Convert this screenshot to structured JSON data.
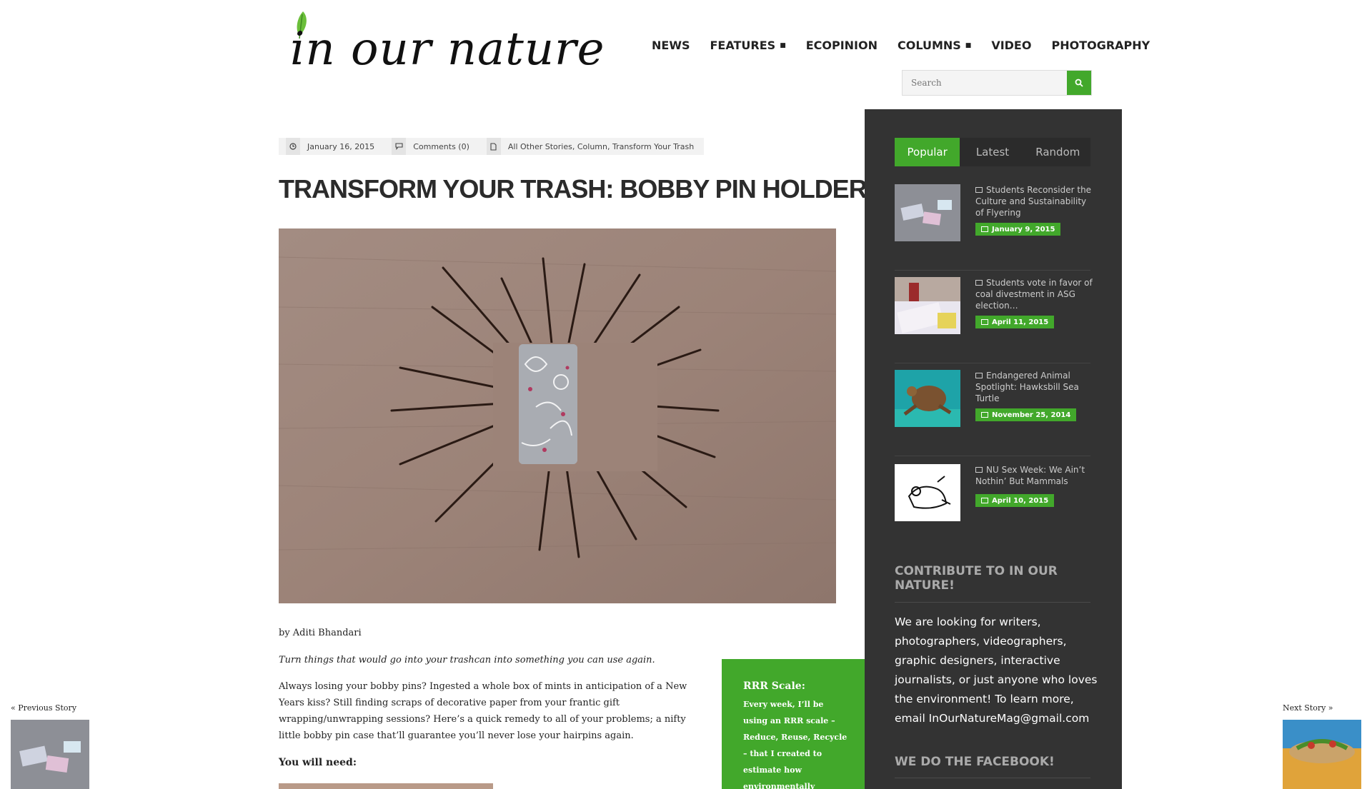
{
  "header": {
    "logo_text": "in our nature",
    "nav": [
      {
        "label": "NEWS",
        "has_dropdown": false
      },
      {
        "label": "FEATURES",
        "has_dropdown": true
      },
      {
        "label": "ECOPINION",
        "has_dropdown": false
      },
      {
        "label": "COLUMNS",
        "has_dropdown": true
      },
      {
        "label": "VIDEO",
        "has_dropdown": false
      },
      {
        "label": "PHOTOGRAPHY",
        "has_dropdown": false
      }
    ],
    "search": {
      "placeholder": "Search",
      "button_icon": "search-icon"
    }
  },
  "article": {
    "meta": {
      "date": "January 16, 2015",
      "comments": "Comments (0)",
      "categories": "All Other Stories, Column, Transform Your Trash"
    },
    "title": "TRANSFORM YOUR TRASH: BOBBY PIN HOLDER",
    "byline": "by Aditi Bhandari",
    "intro": "Turn things that would go into your trashcan into something you can use again.",
    "paragraph": "Always losing your bobby pins? Ingested a whole box of mints in anticipation of a New Years kiss? Still finding scraps of decorative paper from your frantic gift wrapping/unwrapping sessions? Here’s a quick remedy to all of your problems; a nifty little bobby pin case that’ll guarantee you’ll never lose your hairpins again.",
    "you_will_need": "You will need:"
  },
  "rrr_box": {
    "title": "RRR Scale:",
    "text": "Every week, I’ll be using an RRR scale – Reduce, Reuse, Recycle – that I created to estimate how environmentally friendly the project is, based on"
  },
  "sidebar": {
    "tabs": [
      {
        "label": "Popular",
        "active": true
      },
      {
        "label": "Latest",
        "active": false
      },
      {
        "label": "Random",
        "active": false
      }
    ],
    "posts": [
      {
        "title": "Students Reconsider the Culture and Sustainability of Flyering",
        "date": "January 9, 2015"
      },
      {
        "title": "Students vote in favor of coal divestment in ASG election…",
        "date": "April 11, 2015"
      },
      {
        "title": "Endangered Animal Spotlight: Hawksbill Sea Turtle",
        "date": "November 25, 2014"
      },
      {
        "title": "NU Sex Week: We Ain’t Nothin’ But Mammals",
        "date": "April 10, 2015"
      }
    ],
    "contribute": {
      "heading": "CONTRIBUTE TO IN OUR NATURE!",
      "text": "We are looking for writers, photographers, videographers, graphic designers, interactive journalists, or just anyone who loves the environment! To learn more, email InOurNatureMag@gmail.com"
    },
    "facebook_heading": "WE DO THE FACEBOOK!"
  },
  "story_nav": {
    "previous": "« Previous Story",
    "next": "Next Story »"
  },
  "colors": {
    "accent_green": "#42a82b",
    "sidebar_bg": "#333333",
    "title_text": "#2b2b2b"
  }
}
